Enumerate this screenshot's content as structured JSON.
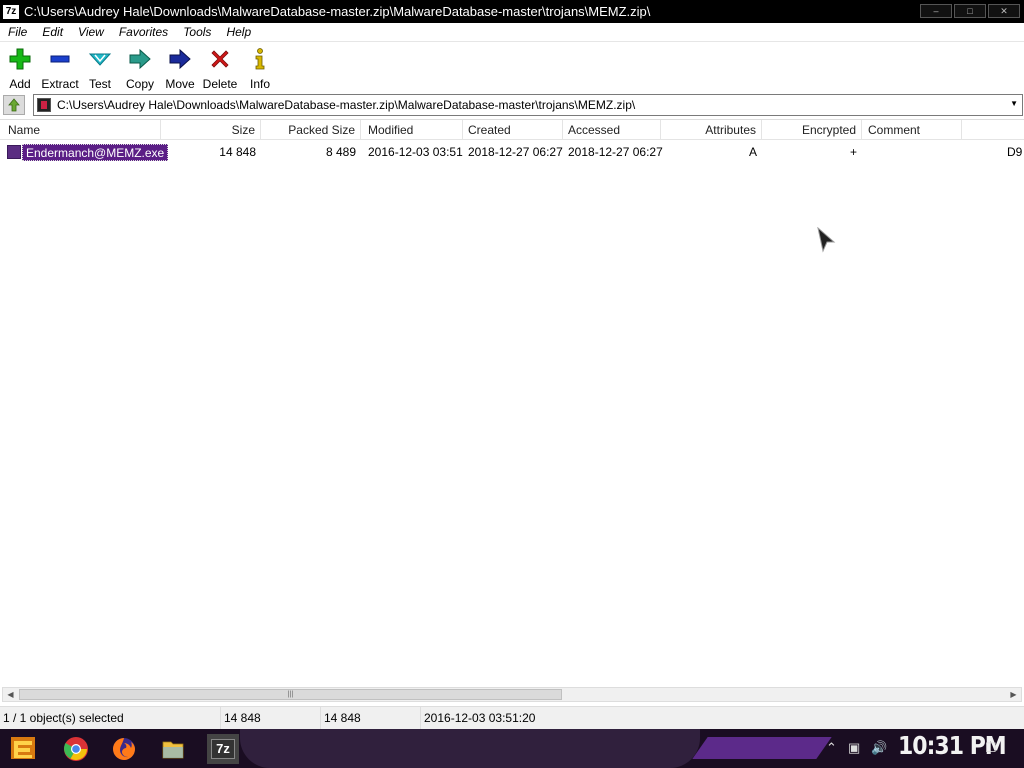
{
  "window": {
    "app_icon_text": "7z",
    "title": "C:\\Users\\Audrey Hale\\Downloads\\MalwareDatabase-master.zip\\MalwareDatabase-master\\trojans\\MEMZ.zip\\"
  },
  "menu": [
    "File",
    "Edit",
    "View",
    "Favorites",
    "Tools",
    "Help"
  ],
  "toolbar": [
    {
      "label": "Add",
      "icon": "plus-icon",
      "color": "#18b818"
    },
    {
      "label": "Extract",
      "icon": "minus-icon",
      "color": "#1a3fcc"
    },
    {
      "label": "Test",
      "icon": "check-icon",
      "color": "#20b8c8"
    },
    {
      "label": "Copy",
      "icon": "copy-arrow-icon",
      "color": "#2a9a8a"
    },
    {
      "label": "Move",
      "icon": "move-arrow-icon",
      "color": "#1a2a9a"
    },
    {
      "label": "Delete",
      "icon": "delete-x-icon",
      "color": "#d01818"
    },
    {
      "label": "Info",
      "icon": "info-icon",
      "color": "#d8b800"
    }
  ],
  "address": {
    "path": "C:\\Users\\Audrey Hale\\Downloads\\MalwareDatabase-master.zip\\MalwareDatabase-master\\trojans\\MEMZ.zip\\"
  },
  "columns": [
    "Name",
    "Size",
    "Packed Size",
    "Modified",
    "Created",
    "Accessed",
    "Attributes",
    "Encrypted",
    "Comment"
  ],
  "files": [
    {
      "name": "Endermanch@MEMZ.exe",
      "size": "14 848",
      "packed_size": "8 489",
      "modified": "2016-12-03 03:51",
      "created": "2018-12-27 06:27",
      "accessed": "2018-12-27 06:27",
      "attributes": "A",
      "encrypted": "+",
      "comment": "",
      "overflow": "D9"
    }
  ],
  "status": {
    "selection": "1 / 1 object(s) selected",
    "size": "14 848",
    "packed": "14 848",
    "modified": "2016-12-03 03:51:20"
  },
  "taskbar": {
    "clock": "10:31 PM",
    "apps": [
      "start-icon",
      "chrome-icon",
      "firefox-icon",
      "file-explorer-icon",
      "7zip-icon"
    ]
  }
}
